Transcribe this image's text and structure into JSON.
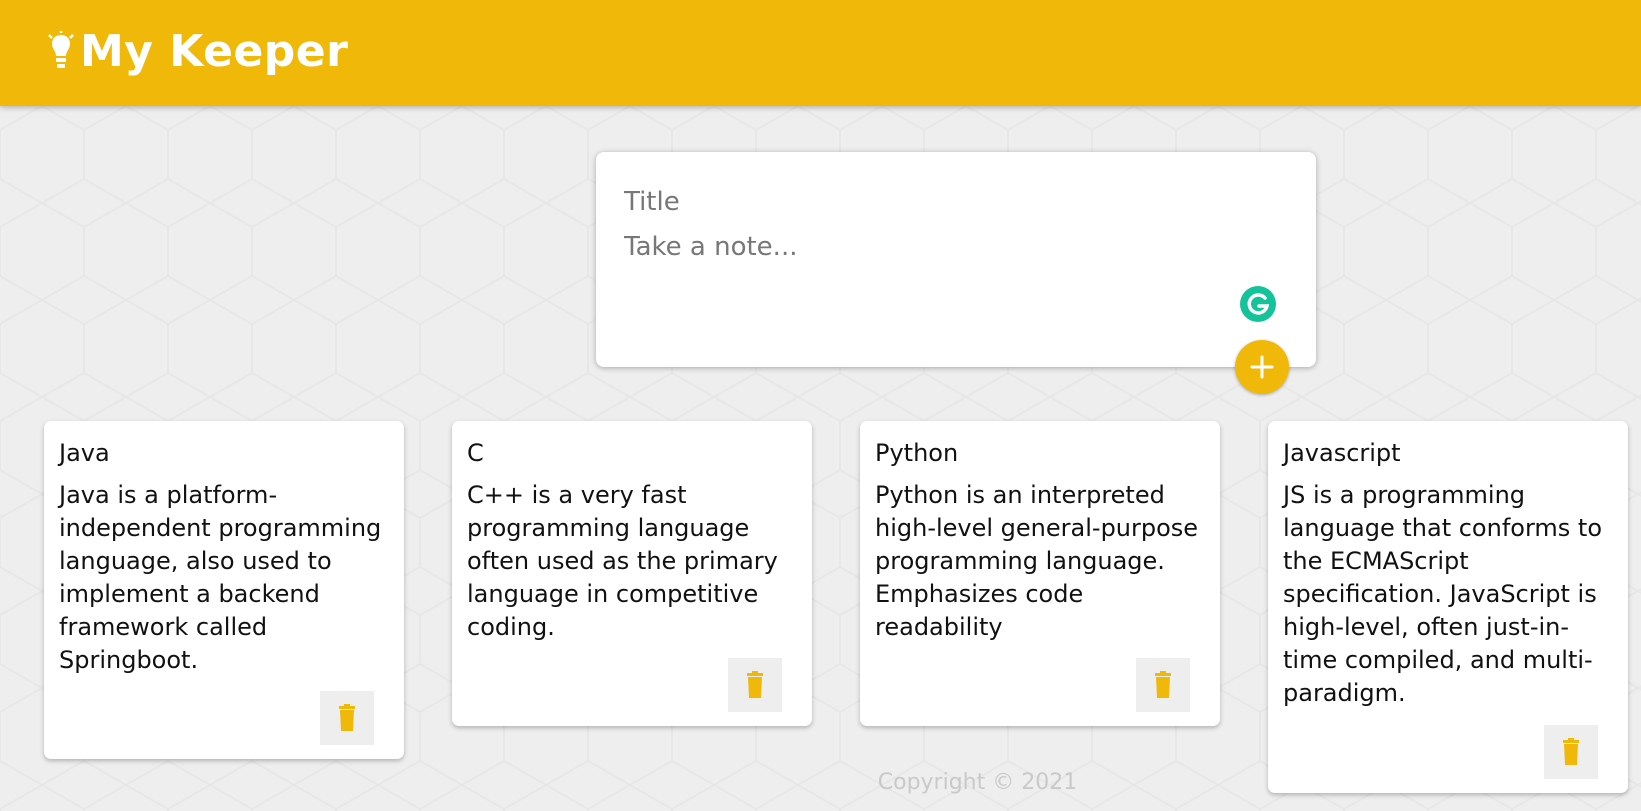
{
  "app": {
    "title": "My Keeper",
    "brand_color": "#f0b90a",
    "icon": "lightbulb-icon"
  },
  "create_note": {
    "title_placeholder": "Title",
    "content_placeholder": "Take a note...",
    "extension_icon": "grammarly-icon",
    "add_icon": "plus-icon"
  },
  "notes": [
    {
      "title": "Java",
      "content": "Java is a platform-independent programming language, also used to implement a backend framework called Springboot.",
      "delete_icon": "trash-icon"
    },
    {
      "title": "C",
      "content": "C++ is a very fast programming language often used as the primary language in competitive coding.",
      "delete_icon": "trash-icon"
    },
    {
      "title": "Python",
      "content": "Python is an interpreted high-level general-purpose programming language. Emphasizes code readability",
      "delete_icon": "trash-icon"
    },
    {
      "title": "Javascript",
      "content": "JS is a programming language that conforms to the ECMAScript specification. JavaScript is high-level, often just-in-time compiled, and multi-paradigm.",
      "delete_icon": "trash-icon"
    }
  ],
  "footer": {
    "copyright": "Copyright © 2021"
  }
}
